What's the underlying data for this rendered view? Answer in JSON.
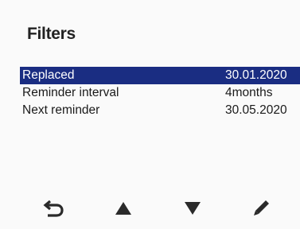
{
  "header": {
    "title": "Filters"
  },
  "list": {
    "rows": [
      {
        "label": "Replaced",
        "value": "30.01.2020",
        "selected": true
      },
      {
        "label": "Reminder interval",
        "value": "4months",
        "selected": false
      },
      {
        "label": "Next reminder",
        "value": "30.05.2020",
        "selected": false
      }
    ]
  },
  "toolbar": {
    "items": [
      {
        "icon": "back-arrow-icon"
      },
      {
        "icon": "arrow-up-icon"
      },
      {
        "icon": "arrow-down-icon"
      },
      {
        "icon": "edit-pencil-icon"
      }
    ]
  },
  "colors": {
    "selection": "#1a2d82",
    "background": "#fafafa",
    "text": "#1e1e1e"
  }
}
